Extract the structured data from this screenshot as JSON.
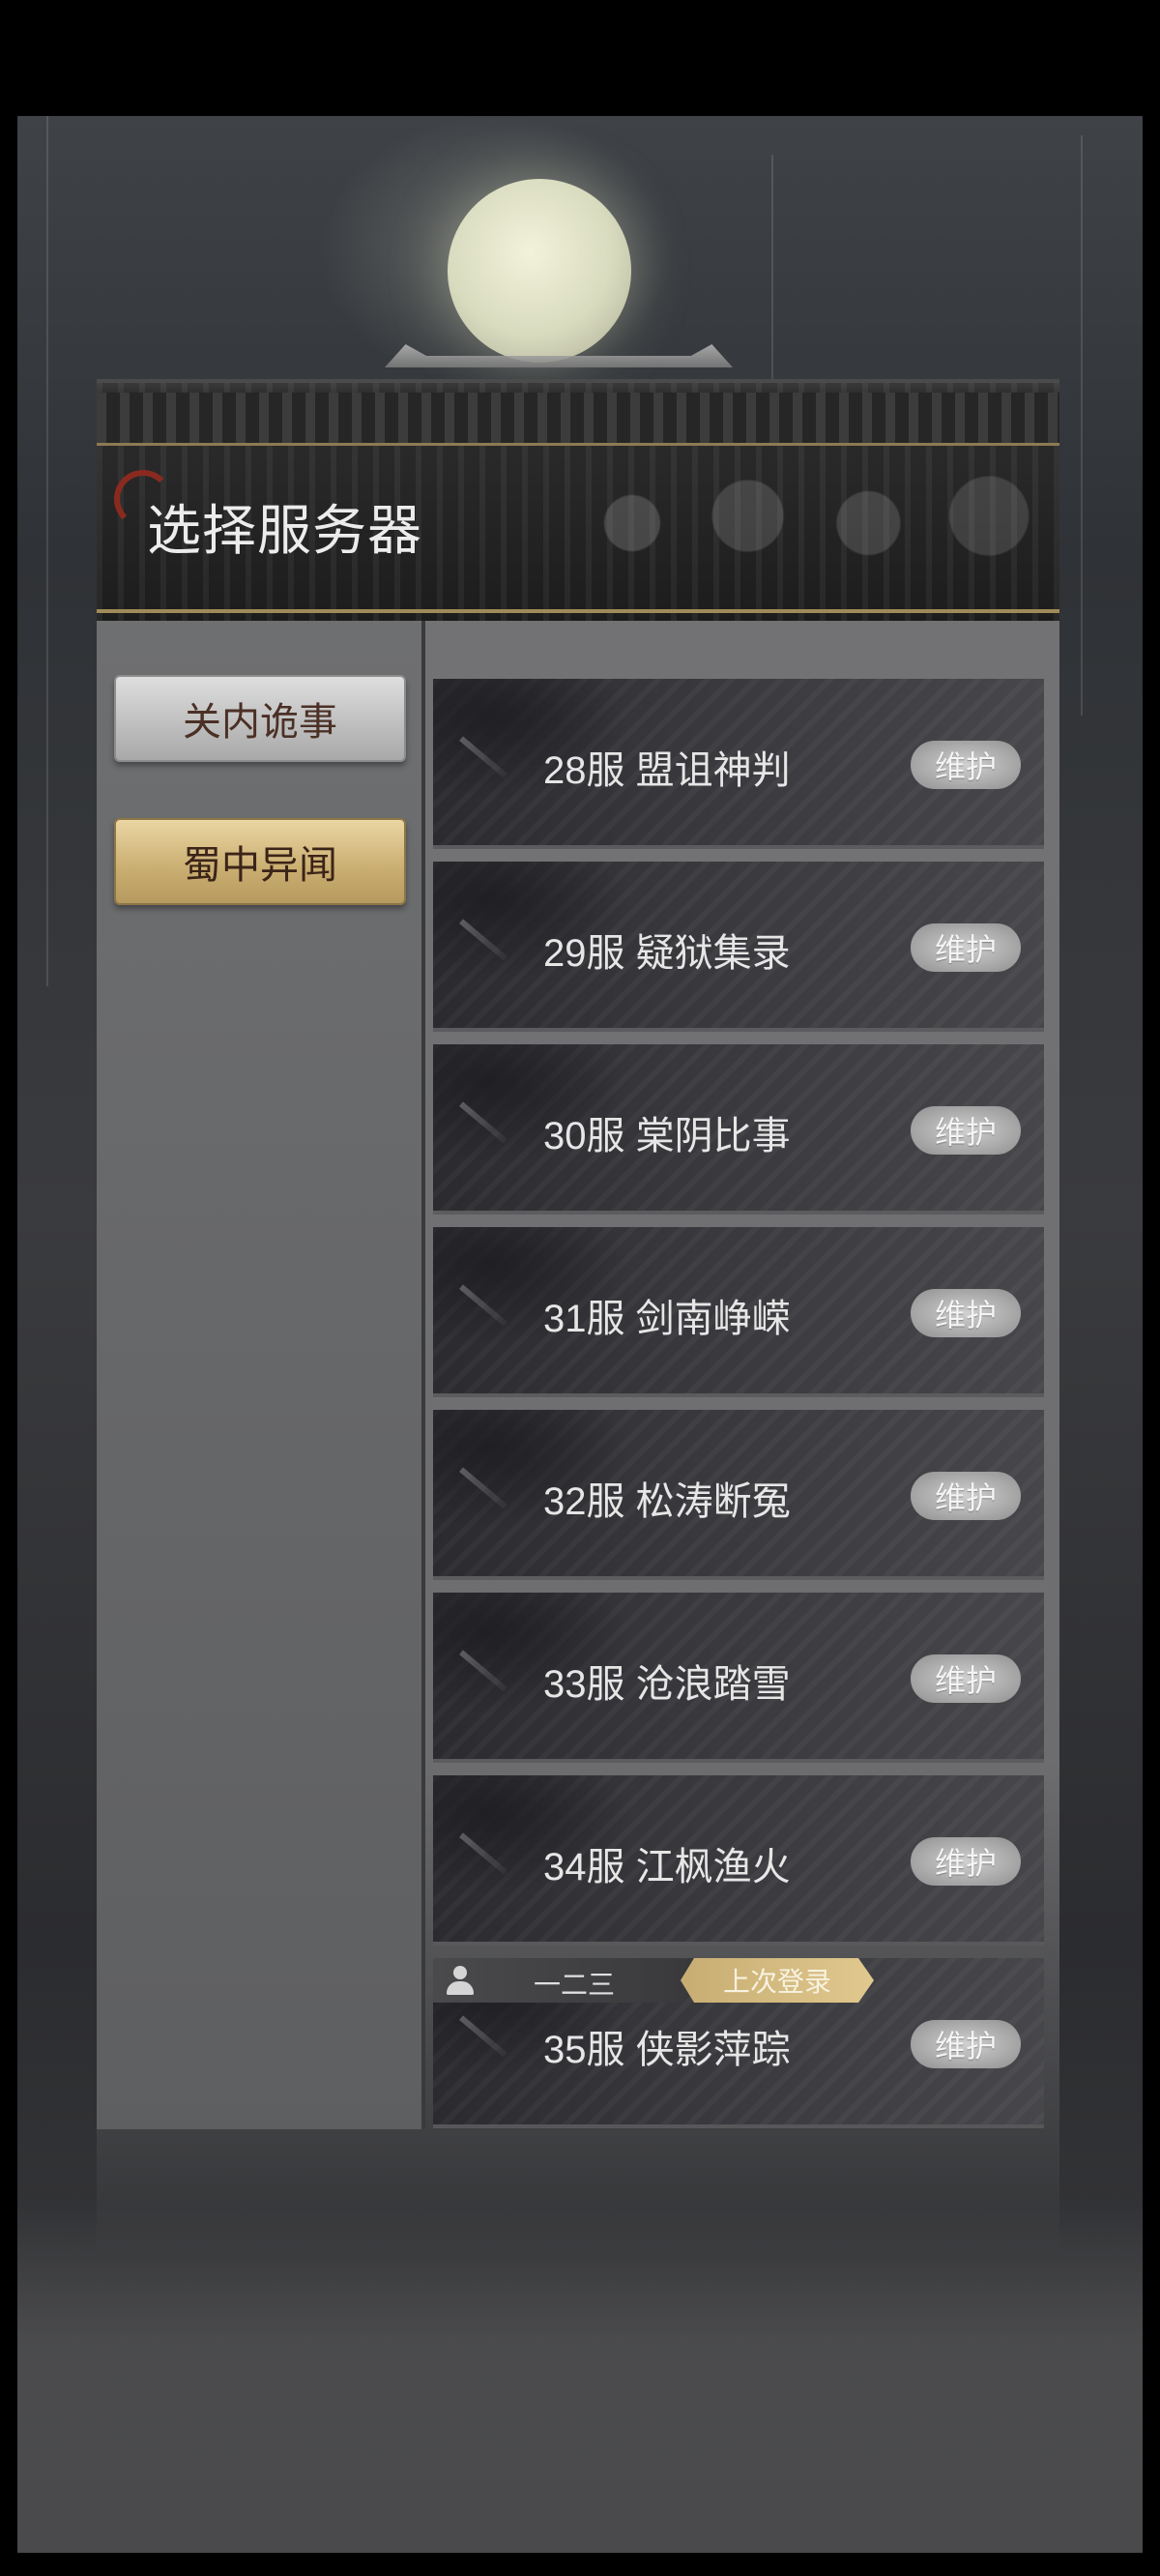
{
  "dialog": {
    "title": "选择服务器"
  },
  "categories": [
    {
      "label": "关内诡事",
      "state": "normal"
    },
    {
      "label": "蜀中异闻",
      "state": "selected"
    }
  ],
  "servers": [
    {
      "name": "28服  盟诅神判",
      "status": "维护"
    },
    {
      "name": "29服  疑狱集录",
      "status": "维护"
    },
    {
      "name": "30服  棠阴比事",
      "status": "维护"
    },
    {
      "name": "31服  剑南峥嵘",
      "status": "维护"
    },
    {
      "name": "32服  松涛断冤",
      "status": "维护"
    },
    {
      "name": "33服  沧浪踏雪",
      "status": "维护"
    },
    {
      "name": "34服  江枫渔火",
      "status": "维护"
    },
    {
      "name": "35服  侠影萍踪",
      "status": "维护"
    }
  ],
  "last_login": {
    "username": "一二三",
    "tag": "上次登录"
  },
  "icons": {
    "avatar": "user-icon",
    "title_mark": "crescent-icon",
    "row_decoration": "sword-icon"
  },
  "colors": {
    "selected_category": "#c9ad70",
    "status_badge": "#a9a9a9",
    "last_login_tag": "#d6bd82"
  }
}
